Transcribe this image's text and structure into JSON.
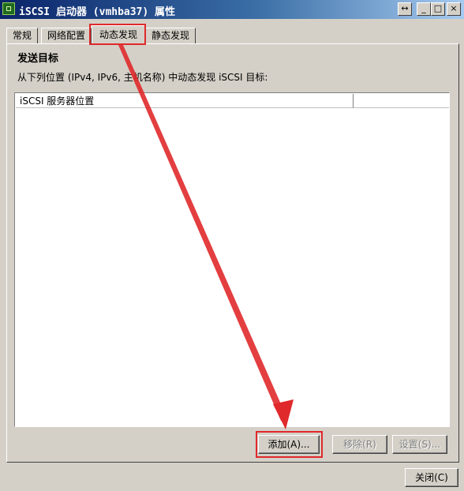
{
  "window": {
    "title": "iSCSI 启动器 (vmhba37) 属性",
    "controls": {
      "restore": "↔",
      "minimize": "_",
      "maximize": "□",
      "close": "×"
    }
  },
  "tabs": [
    {
      "label": "常规",
      "active": false
    },
    {
      "label": "网络配置",
      "active": false
    },
    {
      "label": "动态发现",
      "active": true
    },
    {
      "label": "静态发现",
      "active": false
    }
  ],
  "panel": {
    "section_title": "发送目标",
    "instruction": "从下列位置 (IPv4, IPv6, 主机名称) 中动态发现 iSCSI 目标:",
    "list": {
      "columns": [
        "iSCSI 服务器位置",
        ""
      ],
      "rows": []
    },
    "buttons": {
      "add": "添加(A)...",
      "remove": "移除(R)",
      "settings": "设置(S)..."
    }
  },
  "footer": {
    "close": "关闭(C)"
  },
  "colors": {
    "highlight": "#e0292b",
    "title_bar": "#0a246a",
    "window_bg": "#d4d0c8"
  }
}
